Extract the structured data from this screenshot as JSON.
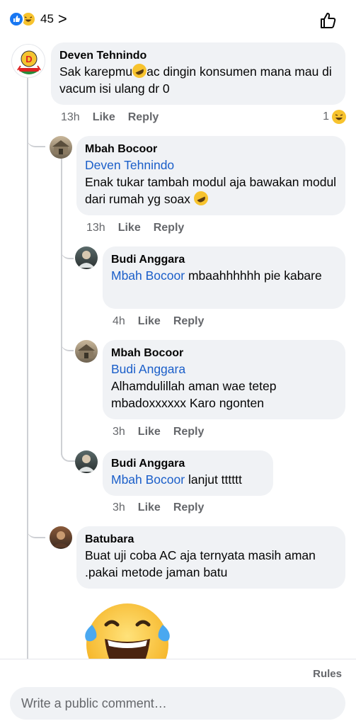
{
  "header": {
    "reaction_count": "45",
    "chevron": ">"
  },
  "comments": [
    {
      "name": "Deven Tehnindo",
      "text_before": "Sak karepmu",
      "text_after": "ac dingin konsumen mana mau di vacum isi ulang dr 0",
      "time": "13h",
      "like": "Like",
      "reply": "Reply",
      "reaction_count": "1"
    },
    {
      "name": "Mbah Bocoor",
      "mention": "Deven Tehnindo",
      "text": "Enak tukar tambah modul aja bawakan modul dari rumah yg soax",
      "time": "13h",
      "like": "Like",
      "reply": "Reply"
    },
    {
      "name": "Budi Anggara",
      "mention": "Mbah Bocoor",
      "text": " mbaahhhhhh pie kabare",
      "time": "4h",
      "like": "Like",
      "reply": "Reply"
    },
    {
      "name": "Mbah Bocoor",
      "mention": "Budi Anggara",
      "text": "Alhamdulillah aman wae tetep mbadoxxxxxx Karo ngonten",
      "time": "3h",
      "like": "Like",
      "reply": "Reply"
    },
    {
      "name": "Budi Anggara",
      "mention": "Mbah Bocoor",
      "text": "lanjut tttttt",
      "time": "3h",
      "like": "Like",
      "reply": "Reply"
    },
    {
      "name": "Batubara",
      "text": "Buat uji coba AC aja ternyata masih aman .pakai metode jaman batu"
    }
  ],
  "footer": {
    "rules": "Rules",
    "placeholder": "Write a public comment…"
  },
  "colors": {
    "like_blue": "#1877f2",
    "mention_blue": "#1a5ec9",
    "bubble_bg": "#f0f2f5",
    "meta_gray": "#65676b"
  }
}
